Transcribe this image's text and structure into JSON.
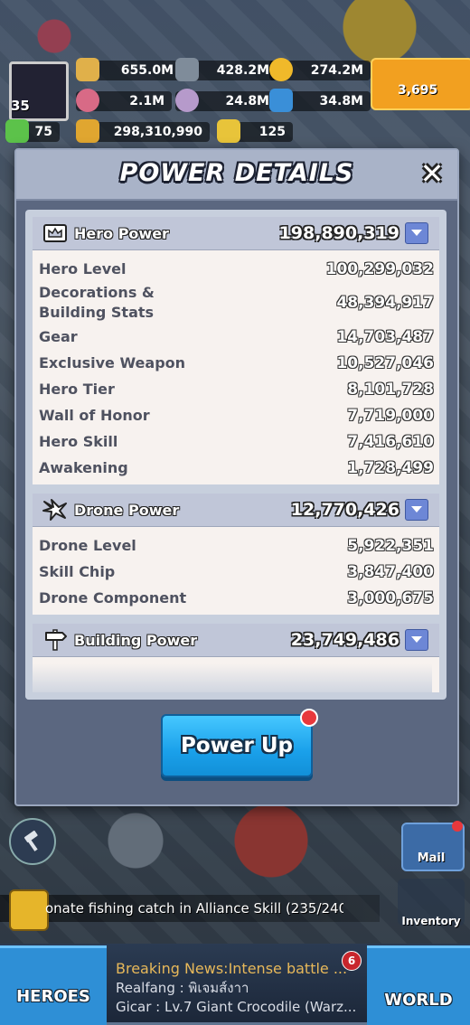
{
  "hud": {
    "player_level": "35",
    "resources_row1": [
      "655.0M",
      "428.2M",
      "274.2M"
    ],
    "resources_row2": [
      "2.1M",
      "24.8M",
      "34.8M"
    ],
    "stamina": "75",
    "total_power": "298,310,990",
    "tickets": "125",
    "gems": "3,695"
  },
  "modal": {
    "title": "POWER DETAILS",
    "sections": [
      {
        "name": "Hero Power",
        "value": "198,890,319",
        "icon": "crown-icon",
        "rows": [
          {
            "label": "Hero Level",
            "value": "100,299,032"
          },
          {
            "label": "Decorations & Building Stats",
            "value": "48,394,917"
          },
          {
            "label": "Gear",
            "value": "14,703,487"
          },
          {
            "label": "Exclusive Weapon",
            "value": "10,527,046"
          },
          {
            "label": "Hero Tier",
            "value": "8,101,728"
          },
          {
            "label": "Wall of Honor",
            "value": "7,719,000"
          },
          {
            "label": "Hero Skill",
            "value": "7,416,610"
          },
          {
            "label": "Awakening",
            "value": "1,728,499"
          }
        ]
      },
      {
        "name": "Drone Power",
        "value": "12,770,426",
        "icon": "drone-icon",
        "rows": [
          {
            "label": "Drone Level",
            "value": "5,922,351"
          },
          {
            "label": "Skill Chip",
            "value": "3,847,400"
          },
          {
            "label": "Drone Component",
            "value": "3,000,675"
          }
        ]
      },
      {
        "name": "Building Power",
        "value": "23,749,486",
        "icon": "signpost-icon",
        "rows": []
      }
    ],
    "power_up_label": "Power Up"
  },
  "side": {
    "mail_label": "Mail",
    "inventory_label": "Inventory"
  },
  "ticker": {
    "text": "onate fishing catch in Alliance Skill (235/240"
  },
  "bottom": {
    "heroes_label": "HEROES",
    "world_label": "WORLD",
    "news_badge": "6",
    "news_line1": "Breaking News:Intense battle ...",
    "news_line2": "Realfang : พิเจมส์งาา",
    "news_line3": "Gicar : Lv.7 Giant Crocodile (Warz..."
  },
  "colors": {
    "modal_bg": "#5b6780",
    "power_up": "#1aa0ea",
    "toggle": "#6d87d6"
  }
}
